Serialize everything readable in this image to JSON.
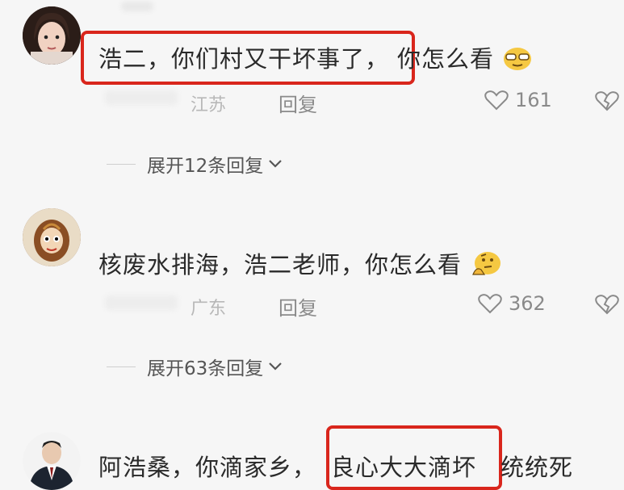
{
  "comments": [
    {
      "text": "浩二，你们村又干坏事了，",
      "text_tail": "你怎么看",
      "emoji": "sunglasses-face-emoji",
      "region": "江苏",
      "reply": "回复",
      "likes": "161",
      "expand": "展开12条回复"
    },
    {
      "text": "核废水排海，浩二老师，你怎么看",
      "emoji": "thinking-face-emoji",
      "region": "广东",
      "reply": "回复",
      "likes": "362",
      "expand": "展开63条回复"
    },
    {
      "text_head": "阿浩桑，你滴家乡，",
      "text_highlight": "良心大大滴坏",
      "text_tail": "统统死"
    }
  ],
  "colors": {
    "highlight_border": "#d9261c",
    "background": "#f6f6f6"
  }
}
